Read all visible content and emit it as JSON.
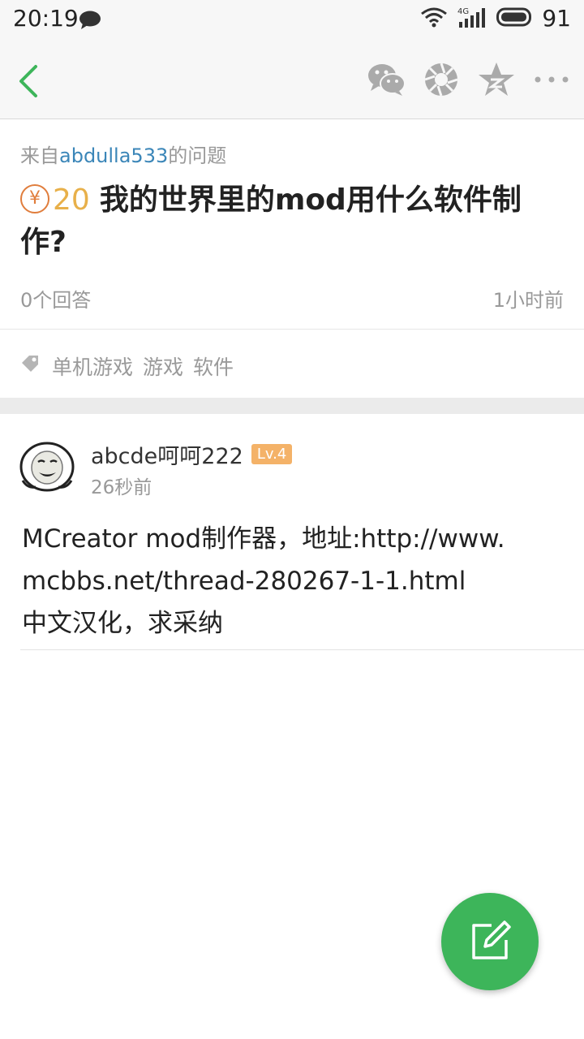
{
  "status_bar": {
    "time": "20:19",
    "network_label": "4G",
    "battery": "91"
  },
  "header": {
    "back_icon": "back-chevron",
    "actions": [
      "wechat-icon",
      "moments-icon",
      "qzone-icon",
      "more-icon"
    ]
  },
  "question": {
    "from_prefix": "来自",
    "from_user": "abdulla533",
    "from_suffix": "的问题",
    "bounty_symbol": "¥",
    "bounty_amount": "20",
    "title": "我的世界里的mod用什么软件制作?",
    "answers_count": "0个回答",
    "time_ago": "1小时前"
  },
  "tags": [
    "单机游戏",
    "游戏",
    "软件"
  ],
  "answer": {
    "username": "abcde呵呵222",
    "level": "Lv.4",
    "time_ago": "26秒前",
    "body_line1": "MCreator mod制作器，地址:http://www.",
    "body_line2": "mcbbs.net/thread-280267-1-1.html",
    "body_line3": "中文汉化，求采纳"
  },
  "colors": {
    "accent_green": "#3db55a",
    "link_blue": "#3b86b8",
    "bounty_orange": "#e07d3c",
    "level_badge": "#f4b268"
  }
}
